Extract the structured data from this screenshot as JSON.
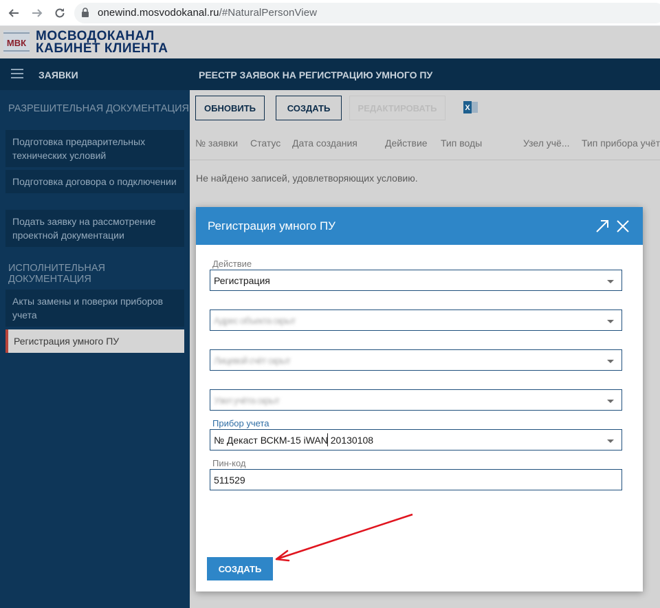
{
  "browser": {
    "url_host": "onewind.mosvodokanal.ru",
    "url_path": "/#NaturalPersonView"
  },
  "header": {
    "brand_line1": "МОСВОДОКАНАЛ",
    "brand_line2": "КАБИНЕТ КЛИЕНТА",
    "logo_text": "МВК",
    "nav_title": "ЗАЯВКИ",
    "page_title": "РЕЕСТР ЗАЯВОК НА РЕГИСТРАЦИЮ УМНОГО ПУ"
  },
  "sidebar": {
    "section1": "РАЗРЕШИТЕЛЬНАЯ ДОКУМЕНТАЦИЯ",
    "items1": [
      {
        "label": "Подготовка предварительных технических условий"
      },
      {
        "label": "Подготовка договора о подключении"
      },
      {
        "label": "Подать заявку на рассмотрение проектной документации"
      }
    ],
    "section2": "ИСПОЛНИТЕЛЬНАЯ ДОКУМЕНТАЦИЯ",
    "items2": [
      {
        "label": "Акты замены и поверки приборов учета"
      },
      {
        "label": "Регистрация умного ПУ"
      }
    ]
  },
  "toolbar": {
    "refresh_label": "ОБНОВИТЬ",
    "create_label": "СОЗДАТЬ",
    "edit_label": "РЕДАКТИРОВАТЬ"
  },
  "grid": {
    "columns": [
      "№ заявки",
      "Статус",
      "Дата создания",
      "Действие",
      "Тип воды",
      "Узел учё...",
      "Тип прибора учёта"
    ],
    "empty_message": "Не найдено записей, удовлетворяющих условию."
  },
  "modal": {
    "title": "Регистрация умного ПУ",
    "action_label": "Действие",
    "action_value": "Регистрация",
    "hidden1": "Адрес объекта скрыт",
    "hidden2": "Лицевой счёт скрыт",
    "hidden3": "Узел учёта скрыт",
    "meter_label": "Прибор учета",
    "meter_value": "№ Декаст ВСКМ-15 iWAN 20130108",
    "pin_label": "Пин-код",
    "pin_value": "511529",
    "create_label": "СОЗДАТЬ"
  },
  "colors": {
    "modal_header": "#2e86c8",
    "sidebar_bg": "#0e3658",
    "brand": "#0d2f63",
    "annotation_arrow": "#e0141e"
  }
}
